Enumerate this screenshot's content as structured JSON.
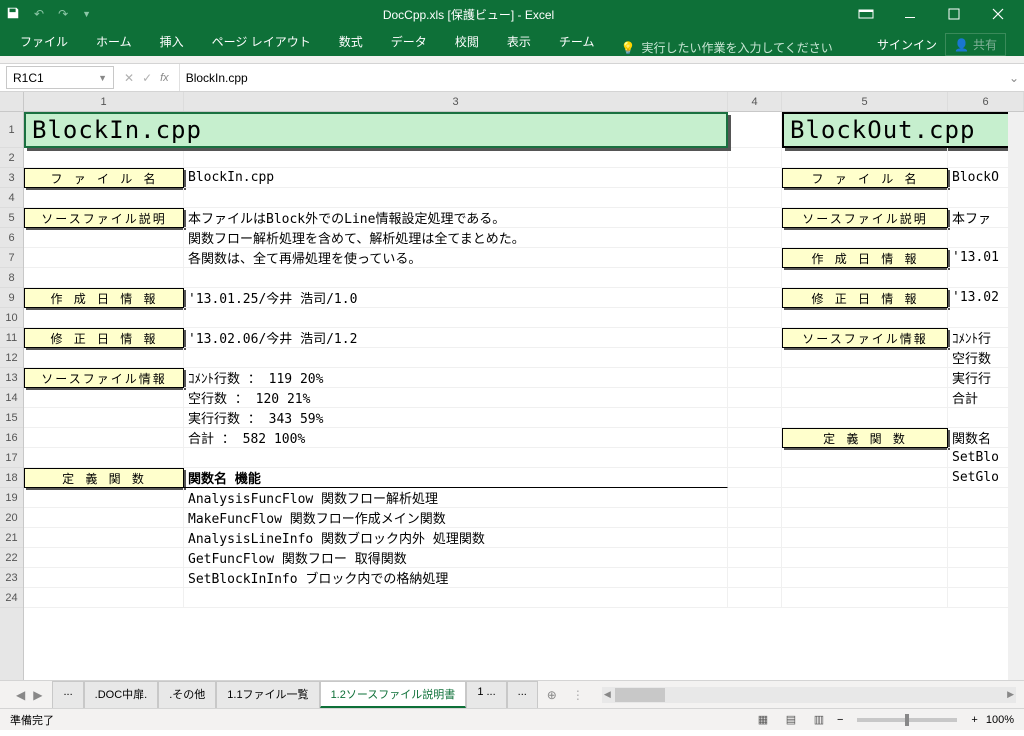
{
  "titlebar": {
    "title": "DocCpp.xls [保護ビュー] - Excel"
  },
  "ribbon": {
    "tabs": [
      "ファイル",
      "ホーム",
      "挿入",
      "ページ レイアウト",
      "数式",
      "データ",
      "校閲",
      "表示",
      "チーム"
    ],
    "tell_me": "実行したい作業を入力してください",
    "signin": "サインイン",
    "share": "共有"
  },
  "formula_bar": {
    "namebox": "R1C1",
    "formula": "BlockIn.cpp"
  },
  "columns": [
    "1",
    "3",
    "4",
    "5",
    "6"
  ],
  "sheet": {
    "rows": [
      {
        "n": "1",
        "h": "tall",
        "cells": [
          {
            "c": "c1",
            "cls": "title-cell selected-cell",
            "span": 2,
            "t": "title1"
          },
          {
            "c": "c4"
          },
          {
            "c": "c5",
            "cls": "title-cell",
            "span": 2,
            "t": "title2"
          }
        ]
      },
      {
        "n": "2",
        "cells": [
          {
            "c": "c1"
          },
          {
            "c": "c3"
          },
          {
            "c": "c4"
          },
          {
            "c": "c5"
          },
          {
            "c": "c6"
          }
        ]
      },
      {
        "n": "3",
        "cells": [
          {
            "c": "c1",
            "cls": "label-cell",
            "t": "l_file"
          },
          {
            "c": "c3",
            "t": "v_file"
          },
          {
            "c": "c4"
          },
          {
            "c": "c5",
            "cls": "label-cell",
            "t": "l_file"
          },
          {
            "c": "c6",
            "t": "v_file2"
          }
        ]
      },
      {
        "n": "4",
        "cells": [
          {
            "c": "c1"
          },
          {
            "c": "c3"
          },
          {
            "c": "c4"
          },
          {
            "c": "c5"
          },
          {
            "c": "c6"
          }
        ]
      },
      {
        "n": "5",
        "cells": [
          {
            "c": "c1",
            "cls": "label-cell",
            "t": "l_src"
          },
          {
            "c": "c3",
            "t": "v_src1"
          },
          {
            "c": "c4"
          },
          {
            "c": "c5",
            "cls": "label-cell",
            "t": "l_src"
          },
          {
            "c": "c6",
            "t": "v_src2"
          }
        ]
      },
      {
        "n": "6",
        "cells": [
          {
            "c": "c1"
          },
          {
            "c": "c3",
            "t": "v_src1b"
          },
          {
            "c": "c4"
          },
          {
            "c": "c5"
          },
          {
            "c": "c6"
          }
        ]
      },
      {
        "n": "7",
        "cells": [
          {
            "c": "c1"
          },
          {
            "c": "c3",
            "t": "v_src1c"
          },
          {
            "c": "c4"
          },
          {
            "c": "c5",
            "cls": "label-cell",
            "t": "l_create"
          },
          {
            "c": "c6",
            "t": "v_create2"
          }
        ]
      },
      {
        "n": "8",
        "cells": [
          {
            "c": "c1"
          },
          {
            "c": "c3"
          },
          {
            "c": "c4"
          },
          {
            "c": "c5"
          },
          {
            "c": "c6"
          }
        ]
      },
      {
        "n": "9",
        "cells": [
          {
            "c": "c1",
            "cls": "label-cell",
            "t": "l_create"
          },
          {
            "c": "c3",
            "t": "v_create"
          },
          {
            "c": "c4"
          },
          {
            "c": "c5",
            "cls": "label-cell",
            "t": "l_modify"
          },
          {
            "c": "c6",
            "t": "v_modify2"
          }
        ]
      },
      {
        "n": "10",
        "cells": [
          {
            "c": "c1"
          },
          {
            "c": "c3"
          },
          {
            "c": "c4"
          },
          {
            "c": "c5"
          },
          {
            "c": "c6"
          }
        ]
      },
      {
        "n": "11",
        "cells": [
          {
            "c": "c1",
            "cls": "label-cell",
            "t": "l_modify"
          },
          {
            "c": "c3",
            "t": "v_modify"
          },
          {
            "c": "c4"
          },
          {
            "c": "c5",
            "cls": "label-cell",
            "t": "l_info"
          },
          {
            "c": "c6",
            "t": "v_info2a"
          }
        ]
      },
      {
        "n": "12",
        "cells": [
          {
            "c": "c1"
          },
          {
            "c": "c3"
          },
          {
            "c": "c4"
          },
          {
            "c": "c5"
          },
          {
            "c": "c6",
            "t": "v_info2b"
          }
        ]
      },
      {
        "n": "13",
        "cells": [
          {
            "c": "c1",
            "cls": "label-cell",
            "t": "l_info"
          },
          {
            "c": "c3",
            "t": "v_info1"
          },
          {
            "c": "c4"
          },
          {
            "c": "c5"
          },
          {
            "c": "c6",
            "t": "v_info2c"
          }
        ]
      },
      {
        "n": "14",
        "cells": [
          {
            "c": "c1"
          },
          {
            "c": "c3",
            "t": "v_info2"
          },
          {
            "c": "c4"
          },
          {
            "c": "c5"
          },
          {
            "c": "c6",
            "t": "v_info2d"
          }
        ]
      },
      {
        "n": "15",
        "cells": [
          {
            "c": "c1"
          },
          {
            "c": "c3",
            "t": "v_info3"
          },
          {
            "c": "c4"
          },
          {
            "c": "c5"
          },
          {
            "c": "c6"
          }
        ]
      },
      {
        "n": "16",
        "cells": [
          {
            "c": "c1"
          },
          {
            "c": "c3",
            "t": "v_info4"
          },
          {
            "c": "c4"
          },
          {
            "c": "c5",
            "cls": "label-cell",
            "t": "l_func"
          },
          {
            "c": "c6",
            "t": "v_func2h"
          }
        ]
      },
      {
        "n": "17",
        "cells": [
          {
            "c": "c1"
          },
          {
            "c": "c3"
          },
          {
            "c": "c4"
          },
          {
            "c": "c5"
          },
          {
            "c": "c6",
            "t": "v_func2a"
          }
        ]
      },
      {
        "n": "18",
        "cells": [
          {
            "c": "c1",
            "cls": "label-cell",
            "t": "l_func"
          },
          {
            "c": "c3",
            "cls": "underline-cell",
            "t": "v_funcH"
          },
          {
            "c": "c4"
          },
          {
            "c": "c5"
          },
          {
            "c": "c6",
            "t": "v_func2b"
          }
        ]
      },
      {
        "n": "19",
        "cells": [
          {
            "c": "c1"
          },
          {
            "c": "c3",
            "t": "v_func1"
          },
          {
            "c": "c4"
          },
          {
            "c": "c5"
          },
          {
            "c": "c6"
          }
        ]
      },
      {
        "n": "20",
        "cells": [
          {
            "c": "c1"
          },
          {
            "c": "c3",
            "t": "v_func2"
          },
          {
            "c": "c4"
          },
          {
            "c": "c5"
          },
          {
            "c": "c6"
          }
        ]
      },
      {
        "n": "21",
        "cells": [
          {
            "c": "c1"
          },
          {
            "c": "c3",
            "t": "v_func3"
          },
          {
            "c": "c4"
          },
          {
            "c": "c5"
          },
          {
            "c": "c6"
          }
        ]
      },
      {
        "n": "22",
        "cells": [
          {
            "c": "c1"
          },
          {
            "c": "c3",
            "t": "v_func4"
          },
          {
            "c": "c4"
          },
          {
            "c": "c5"
          },
          {
            "c": "c6"
          }
        ]
      },
      {
        "n": "23",
        "cells": [
          {
            "c": "c1"
          },
          {
            "c": "c3",
            "t": "v_func5"
          },
          {
            "c": "c4"
          },
          {
            "c": "c5"
          },
          {
            "c": "c6"
          }
        ]
      },
      {
        "n": "24",
        "cells": [
          {
            "c": "c1"
          },
          {
            "c": "c3"
          },
          {
            "c": "c4"
          },
          {
            "c": "c5"
          },
          {
            "c": "c6"
          }
        ]
      }
    ],
    "text": {
      "title1": "BlockIn.cpp",
      "title2": "BlockOut.cpp",
      "l_file": "フ ァ イ ル 名",
      "v_file": "BlockIn.cpp",
      "v_file2": "BlockO",
      "l_src": "ソースファイル説明",
      "v_src1": "本ファイルはBlock外でのLine情報設定処理である。",
      "v_src1b": "関数フロー解析処理を含めて、解析処理は全てまとめた。",
      "v_src1c": "各関数は、全て再帰処理を使っている。",
      "v_src2": "本ファ",
      "l_create": "作 成 日 情 報",
      "v_create": "'13.01.25/今井 浩司/1.0",
      "v_create2": "'13.01",
      "l_modify": "修 正 日 情 報",
      "v_modify": "'13.02.06/今井 浩司/1.2",
      "v_modify2": "'13.02",
      "l_info": "ソースファイル情報",
      "v_info1": "ｺﾒﾝﾄ行数 ：   119    20%",
      "v_info2": "空行数   ：   120    21%",
      "v_info3": "実行行数 ：   343    59%",
      "v_info4": "合計     ：   582   100%",
      "v_info2a": "ｺﾒﾝﾄ行",
      "v_info2b": "空行数",
      "v_info2c": "実行行",
      "v_info2d": "合計",
      "l_func": "定 義 関 数",
      "v_funcH": "関数名                機能",
      "v_func1": "AnalysisFuncFlow 関数フロー解析処理",
      "v_func2": "MakeFuncFlow     関数フロー作成メイン関数",
      "v_func3": "AnalysisLineInfo 関数ブロック内外 処理関数",
      "v_func4": "GetFuncFlow      関数フロー 取得関数",
      "v_func5": "SetBlockInInfo   ブロック内での格納処理",
      "v_func2h": "関数名",
      "v_func2a": "SetBlo",
      "v_func2b": "SetGlo"
    }
  },
  "sheet_tabs": {
    "tabs": [
      "...",
      ".DOC中扉.",
      ".その他",
      "1.1ファイル一覧",
      "1.2ソースファイル説明書",
      "1 ...",
      "..."
    ],
    "active_index": 4
  },
  "status": {
    "ready": "準備完了",
    "zoom": "100%"
  }
}
